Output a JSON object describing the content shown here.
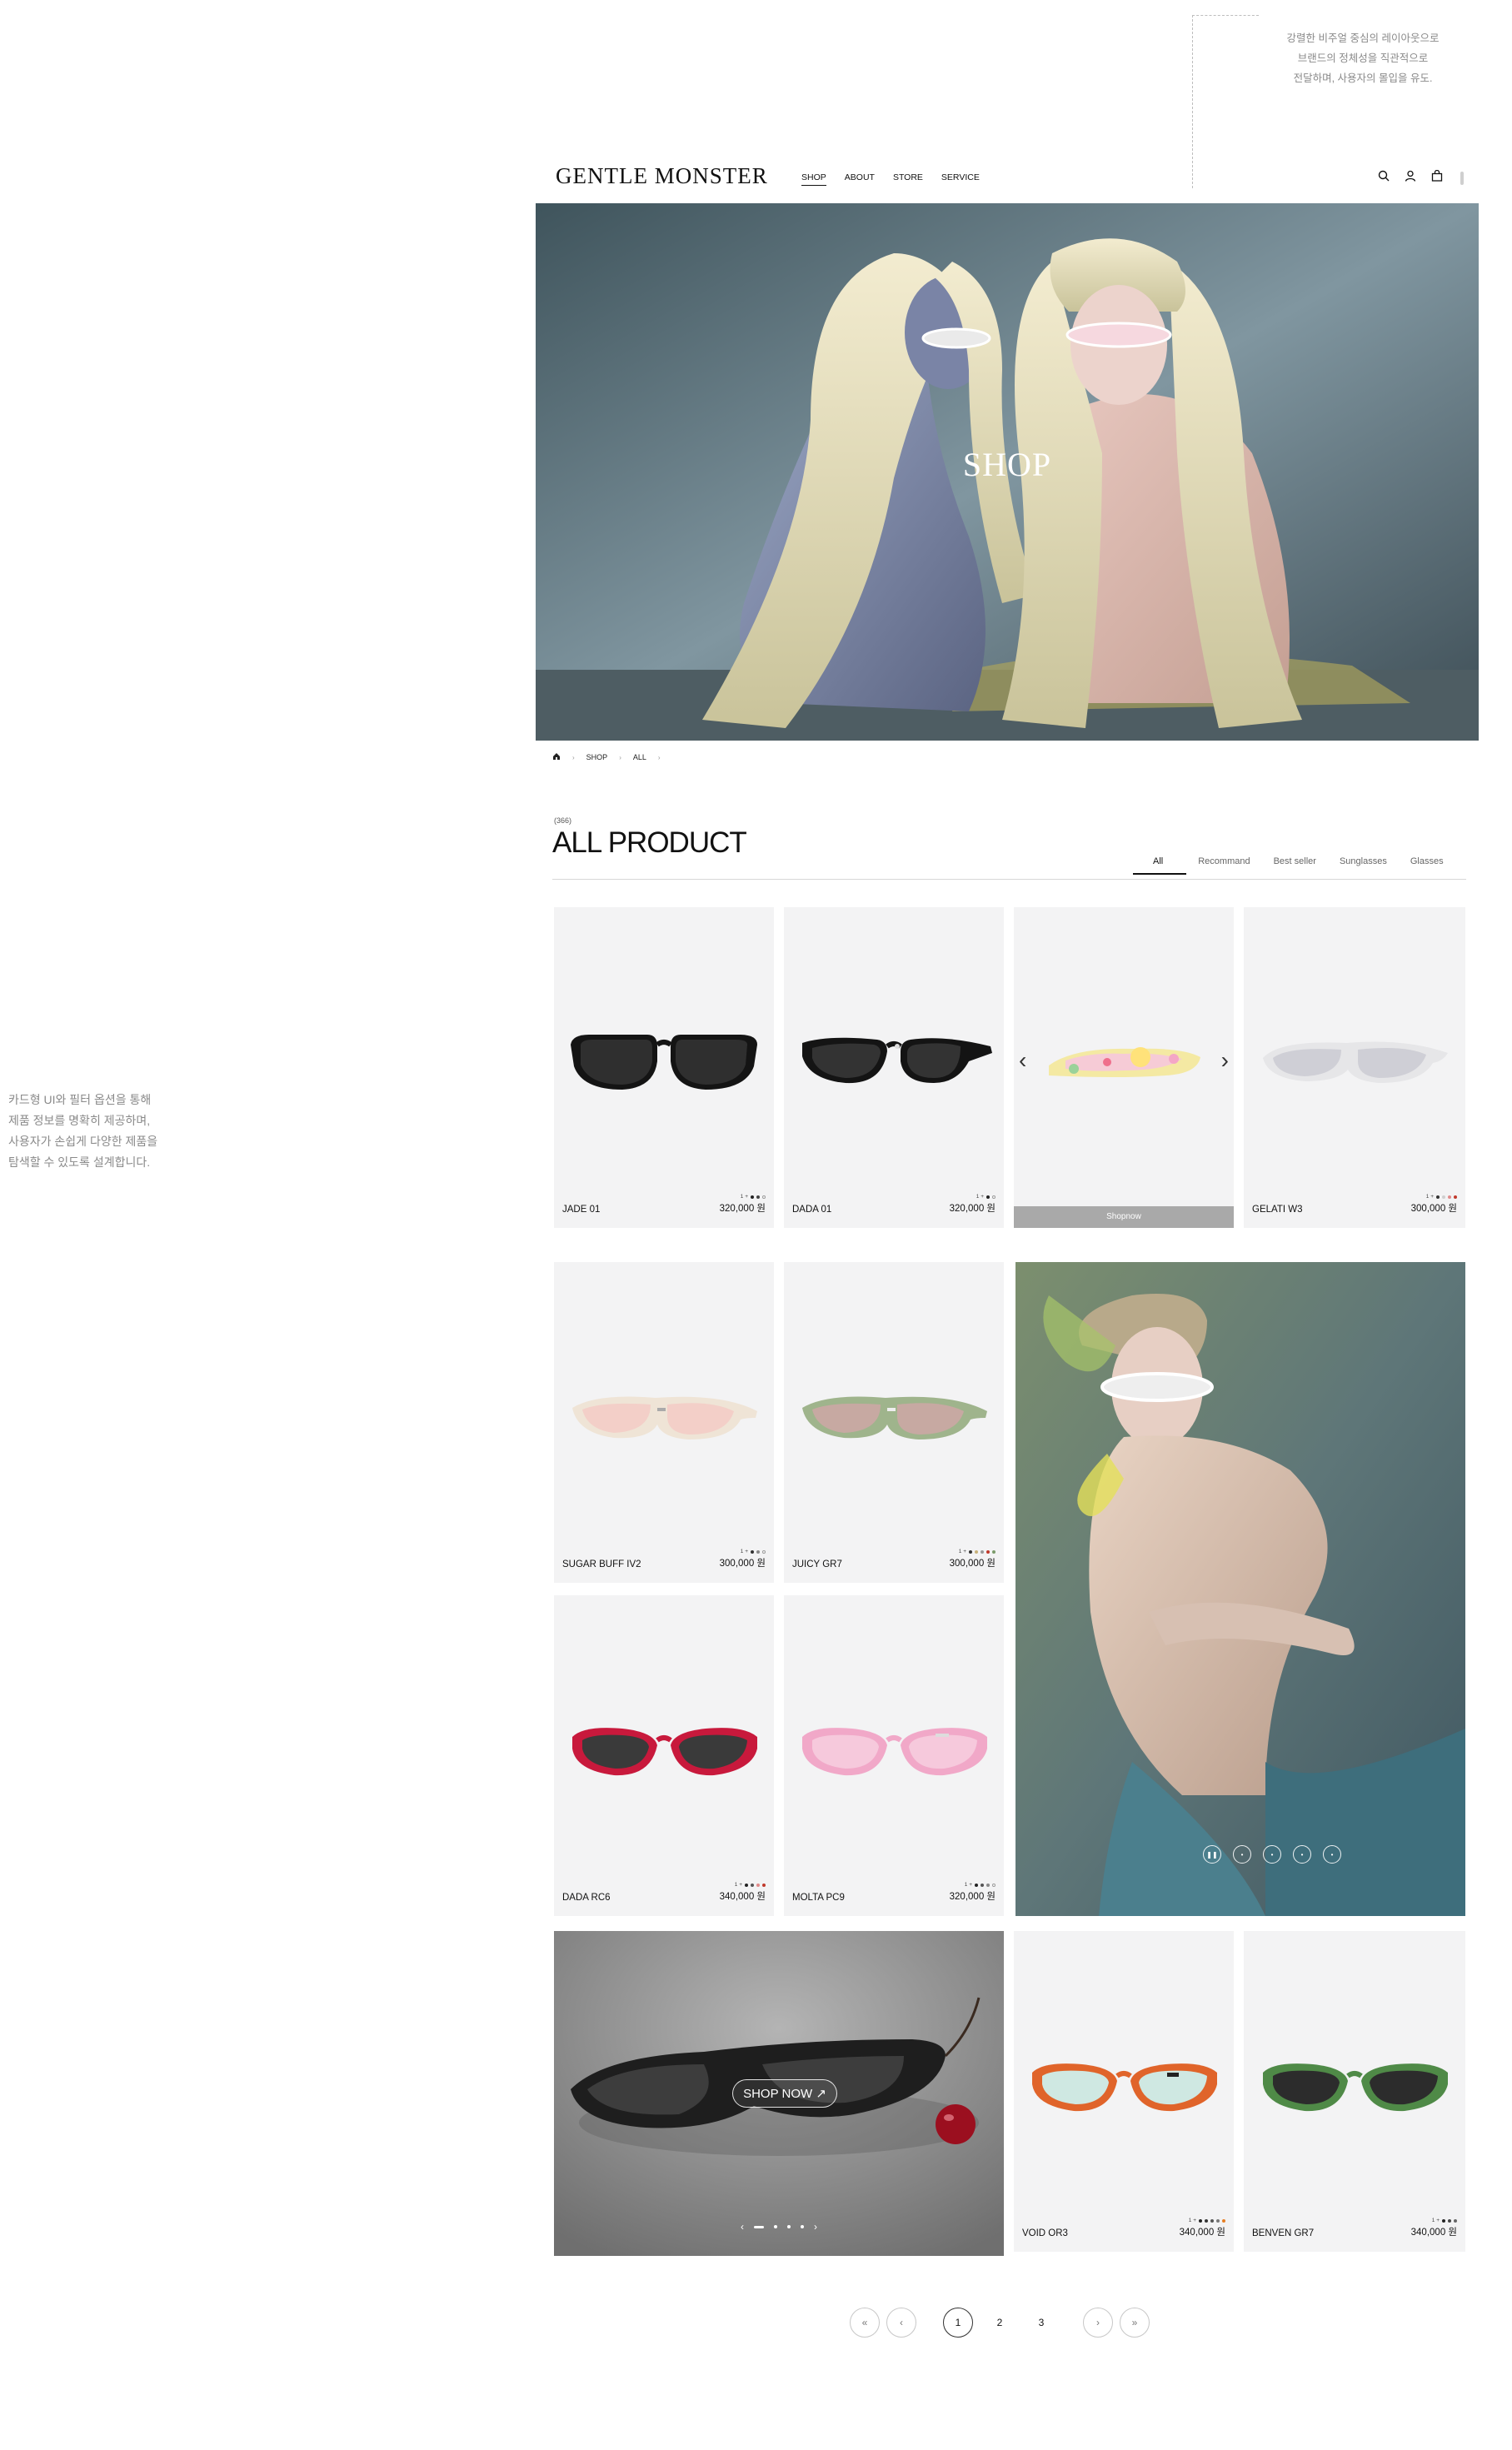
{
  "annotations": {
    "top_line1": "강렬한 비주얼 중심의 레이아웃으로",
    "top_line2": "브랜드의 정체성을 직관적으로",
    "top_line3": "전달하며, 사용자의 몰입을 유도.",
    "left_line1": "카드형 UI와 필터 옵션을 통해",
    "left_line2": "제품 정보를 명확히 제공하며,",
    "left_line3": "사용자가 손쉽게 다양한 제품을",
    "left_line4": "탐색할 수 있도록 설계합니다."
  },
  "header": {
    "logo": "GENTLE MONSTER",
    "nav": [
      "SHOP",
      "ABOUT",
      "STORE",
      "SERVICE"
    ],
    "icons": [
      "search-icon",
      "user-icon",
      "bag-icon"
    ]
  },
  "hero": {
    "title": "SHOP"
  },
  "breadcrumb": {
    "items": [
      "SHOP",
      "ALL"
    ]
  },
  "section": {
    "count": "(366)",
    "title": "ALL PRODUCT",
    "tabs": [
      "All",
      "Recommand",
      "Best seller",
      "Sunglasses",
      "Glasses"
    ]
  },
  "products": [
    {
      "name": "JADE 01",
      "price": "320,000 원",
      "swatch_label": "1 +",
      "colors": [
        "#222222",
        "#444444",
        "#ffffff"
      ]
    },
    {
      "name": "DADA 01",
      "price": "320,000 원",
      "swatch_label": "1 +",
      "colors": [
        "#222222",
        "#ffffff"
      ]
    },
    {
      "button": "Shopnow"
    },
    {
      "name": "GELATI W3",
      "price": "300,000 원",
      "swatch_label": "1 +",
      "colors": [
        "#333333",
        "#cfcfcf",
        "#e08a8a",
        "#c0392b"
      ]
    },
    {
      "name": "SUGAR BUFF IV2",
      "price": "300,000 원",
      "swatch_label": "1 +",
      "colors": [
        "#333333",
        "#888888",
        "#ffffff"
      ]
    },
    {
      "name": "JUICY GR7",
      "price": "300,000 원",
      "swatch_label": "1 +",
      "colors": [
        "#333333",
        "#c8b27a",
        "#999999",
        "#c0392b",
        "#7b9b6b"
      ]
    },
    {
      "name": "DADA RC6",
      "price": "340,000 원",
      "swatch_label": "1 +",
      "colors": [
        "#222222",
        "#555555",
        "#e08a8a",
        "#c0392b"
      ]
    },
    {
      "name": "MOLTA PC9",
      "price": "320,000 원",
      "swatch_label": "1 +",
      "colors": [
        "#222222",
        "#555555",
        "#888888",
        "#ffffff"
      ]
    },
    {
      "name": "VOID OR3",
      "price": "340,000 원",
      "swatch_label": "1 +",
      "colors": [
        "#222222",
        "#333333",
        "#555555",
        "#777777",
        "#e67e22"
      ]
    },
    {
      "name": "BENVEN GR7",
      "price": "340,000 원",
      "swatch_label": "1 +",
      "colors": [
        "#222222",
        "#444444",
        "#666666"
      ]
    }
  ],
  "banner": {
    "button": "SHOP NOW ↗",
    "pager_left": "‹",
    "pager_right": "›"
  },
  "pagination": {
    "first": "«",
    "prev": "‹",
    "pages": [
      "1",
      "2",
      "3"
    ],
    "next": "›",
    "last": "»"
  },
  "colors": {
    "accent": "#111111",
    "card_bg": "#f3f3f4",
    "annotation": "#8a8a8a"
  }
}
